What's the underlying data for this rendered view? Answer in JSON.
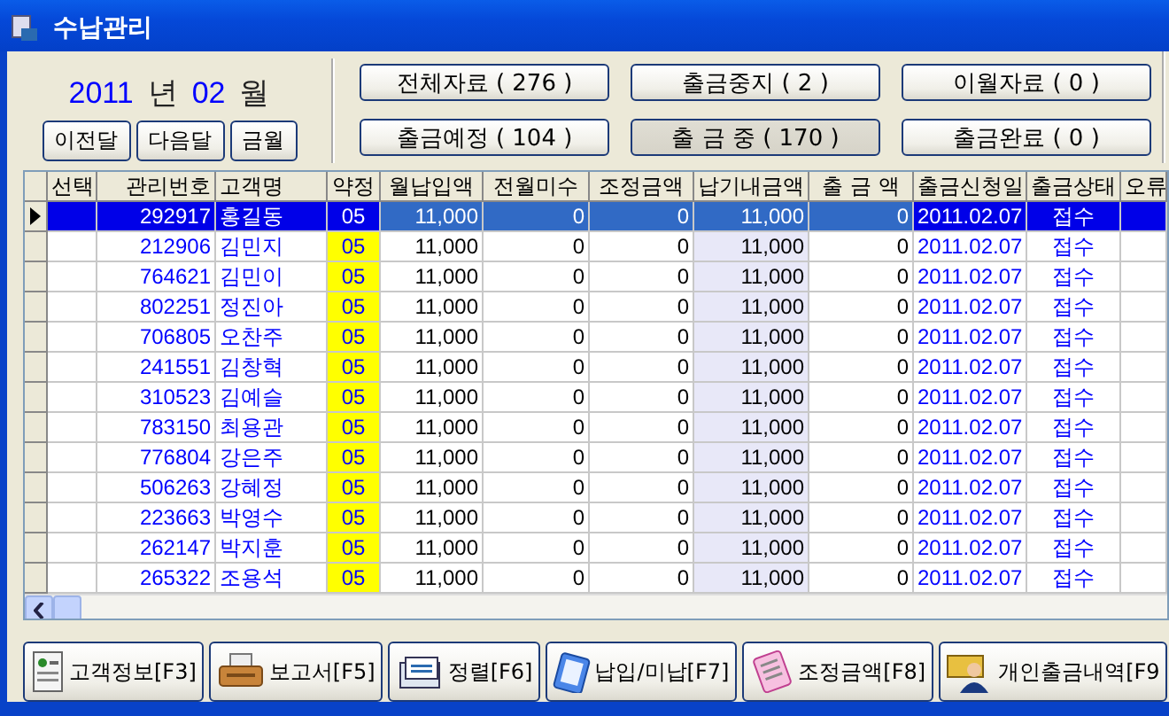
{
  "window": {
    "title": "수납관리"
  },
  "period": {
    "year": "2011",
    "year_unit": "년",
    "month": "02",
    "month_unit": "월"
  },
  "period_buttons": [
    "이전달",
    "다음달",
    "금월"
  ],
  "filters": [
    {
      "label": "전체자료 ( 276 )",
      "selected": false
    },
    {
      "label": "출금중지 ( 2 )",
      "selected": false
    },
    {
      "label": "이월자료 ( 0 )",
      "selected": false
    },
    {
      "label": "출금예정 ( 104 )",
      "selected": false
    },
    {
      "label": "출 금 중 ( 170 )",
      "selected": true
    },
    {
      "label": "출금완료 ( 0 )",
      "selected": false
    }
  ],
  "table": {
    "columns": [
      "선택",
      "관리번호",
      "고객명",
      "약정",
      "월납입액",
      "전월미수",
      "조정금액",
      "납기내금액",
      "출 금 액",
      "출금신청일",
      "출금상태",
      "오류"
    ],
    "rows": [
      {
        "selected": true,
        "cells": [
          "",
          "292917",
          "홍길동",
          "05",
          "11,000",
          "0",
          "0",
          "11,000",
          "0",
          "2011.02.07",
          "접수",
          ""
        ]
      },
      {
        "selected": false,
        "cells": [
          "",
          "212906",
          "김민지",
          "05",
          "11,000",
          "0",
          "0",
          "11,000",
          "0",
          "2011.02.07",
          "접수",
          ""
        ]
      },
      {
        "selected": false,
        "cells": [
          "",
          "764621",
          "김민이",
          "05",
          "11,000",
          "0",
          "0",
          "11,000",
          "0",
          "2011.02.07",
          "접수",
          ""
        ]
      },
      {
        "selected": false,
        "cells": [
          "",
          "802251",
          "정진아",
          "05",
          "11,000",
          "0",
          "0",
          "11,000",
          "0",
          "2011.02.07",
          "접수",
          ""
        ]
      },
      {
        "selected": false,
        "cells": [
          "",
          "706805",
          "오찬주",
          "05",
          "11,000",
          "0",
          "0",
          "11,000",
          "0",
          "2011.02.07",
          "접수",
          ""
        ]
      },
      {
        "selected": false,
        "cells": [
          "",
          "241551",
          "김창혁",
          "05",
          "11,000",
          "0",
          "0",
          "11,000",
          "0",
          "2011.02.07",
          "접수",
          ""
        ]
      },
      {
        "selected": false,
        "cells": [
          "",
          "310523",
          "김예슬",
          "05",
          "11,000",
          "0",
          "0",
          "11,000",
          "0",
          "2011.02.07",
          "접수",
          ""
        ]
      },
      {
        "selected": false,
        "cells": [
          "",
          "783150",
          "최용관",
          "05",
          "11,000",
          "0",
          "0",
          "11,000",
          "0",
          "2011.02.07",
          "접수",
          ""
        ]
      },
      {
        "selected": false,
        "cells": [
          "",
          "776804",
          "강은주",
          "05",
          "11,000",
          "0",
          "0",
          "11,000",
          "0",
          "2011.02.07",
          "접수",
          ""
        ]
      },
      {
        "selected": false,
        "cells": [
          "",
          "506263",
          "강혜정",
          "05",
          "11,000",
          "0",
          "0",
          "11,000",
          "0",
          "2011.02.07",
          "접수",
          ""
        ]
      },
      {
        "selected": false,
        "cells": [
          "",
          "223663",
          "박영수",
          "05",
          "11,000",
          "0",
          "0",
          "11,000",
          "0",
          "2011.02.07",
          "접수",
          ""
        ]
      },
      {
        "selected": false,
        "cells": [
          "",
          "262147",
          "박지훈",
          "05",
          "11,000",
          "0",
          "0",
          "11,000",
          "0",
          "2011.02.07",
          "접수",
          ""
        ]
      },
      {
        "selected": false,
        "cells": [
          "",
          "265322",
          "조용석",
          "05",
          "11,000",
          "0",
          "0",
          "11,000",
          "0",
          "2011.02.07",
          "접수",
          ""
        ]
      }
    ]
  },
  "actions": [
    {
      "label": "고객정보[F3]",
      "kind": "card"
    },
    {
      "label": "보고서[F5]",
      "kind": "printer"
    },
    {
      "label": "정렬[F6]",
      "kind": "stack"
    },
    {
      "label": "납입/미납[F7]",
      "kind": "clipboard"
    },
    {
      "label": "조정금액[F8]",
      "kind": "notepad"
    },
    {
      "label": "개인출금내역[F9",
      "kind": "person"
    }
  ]
}
